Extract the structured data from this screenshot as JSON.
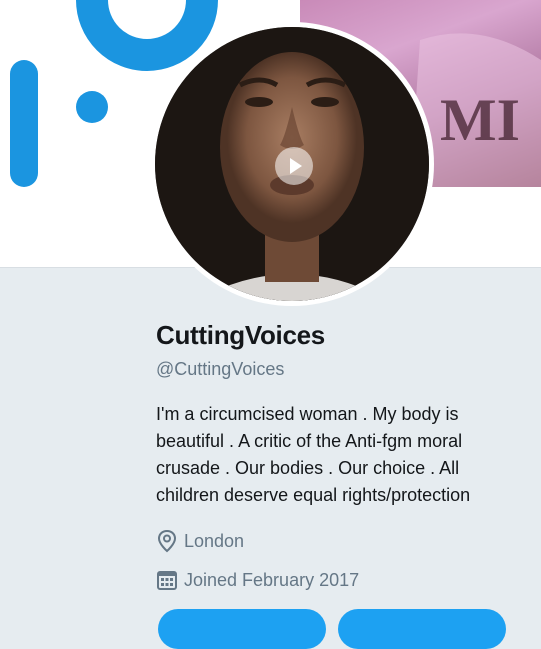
{
  "colors": {
    "accent": "#1da1f2",
    "brand_blue": "#1b95e0",
    "page_bg": "#e6ecf0",
    "text_primary": "#14171a",
    "text_secondary": "#657786"
  },
  "profile": {
    "display_name": "CuttingVoices",
    "handle": "@CuttingVoices",
    "bio": "I'm a circumcised woman . My body is beautiful . A critic of the Anti-fgm moral crusade . Our bodies . Our choice . All children deserve equal rights/protection",
    "location": "London",
    "joined": "Joined February 2017",
    "avatar_icon": "play-icon",
    "location_icon": "map-pin-icon",
    "joined_icon": "calendar-icon"
  }
}
